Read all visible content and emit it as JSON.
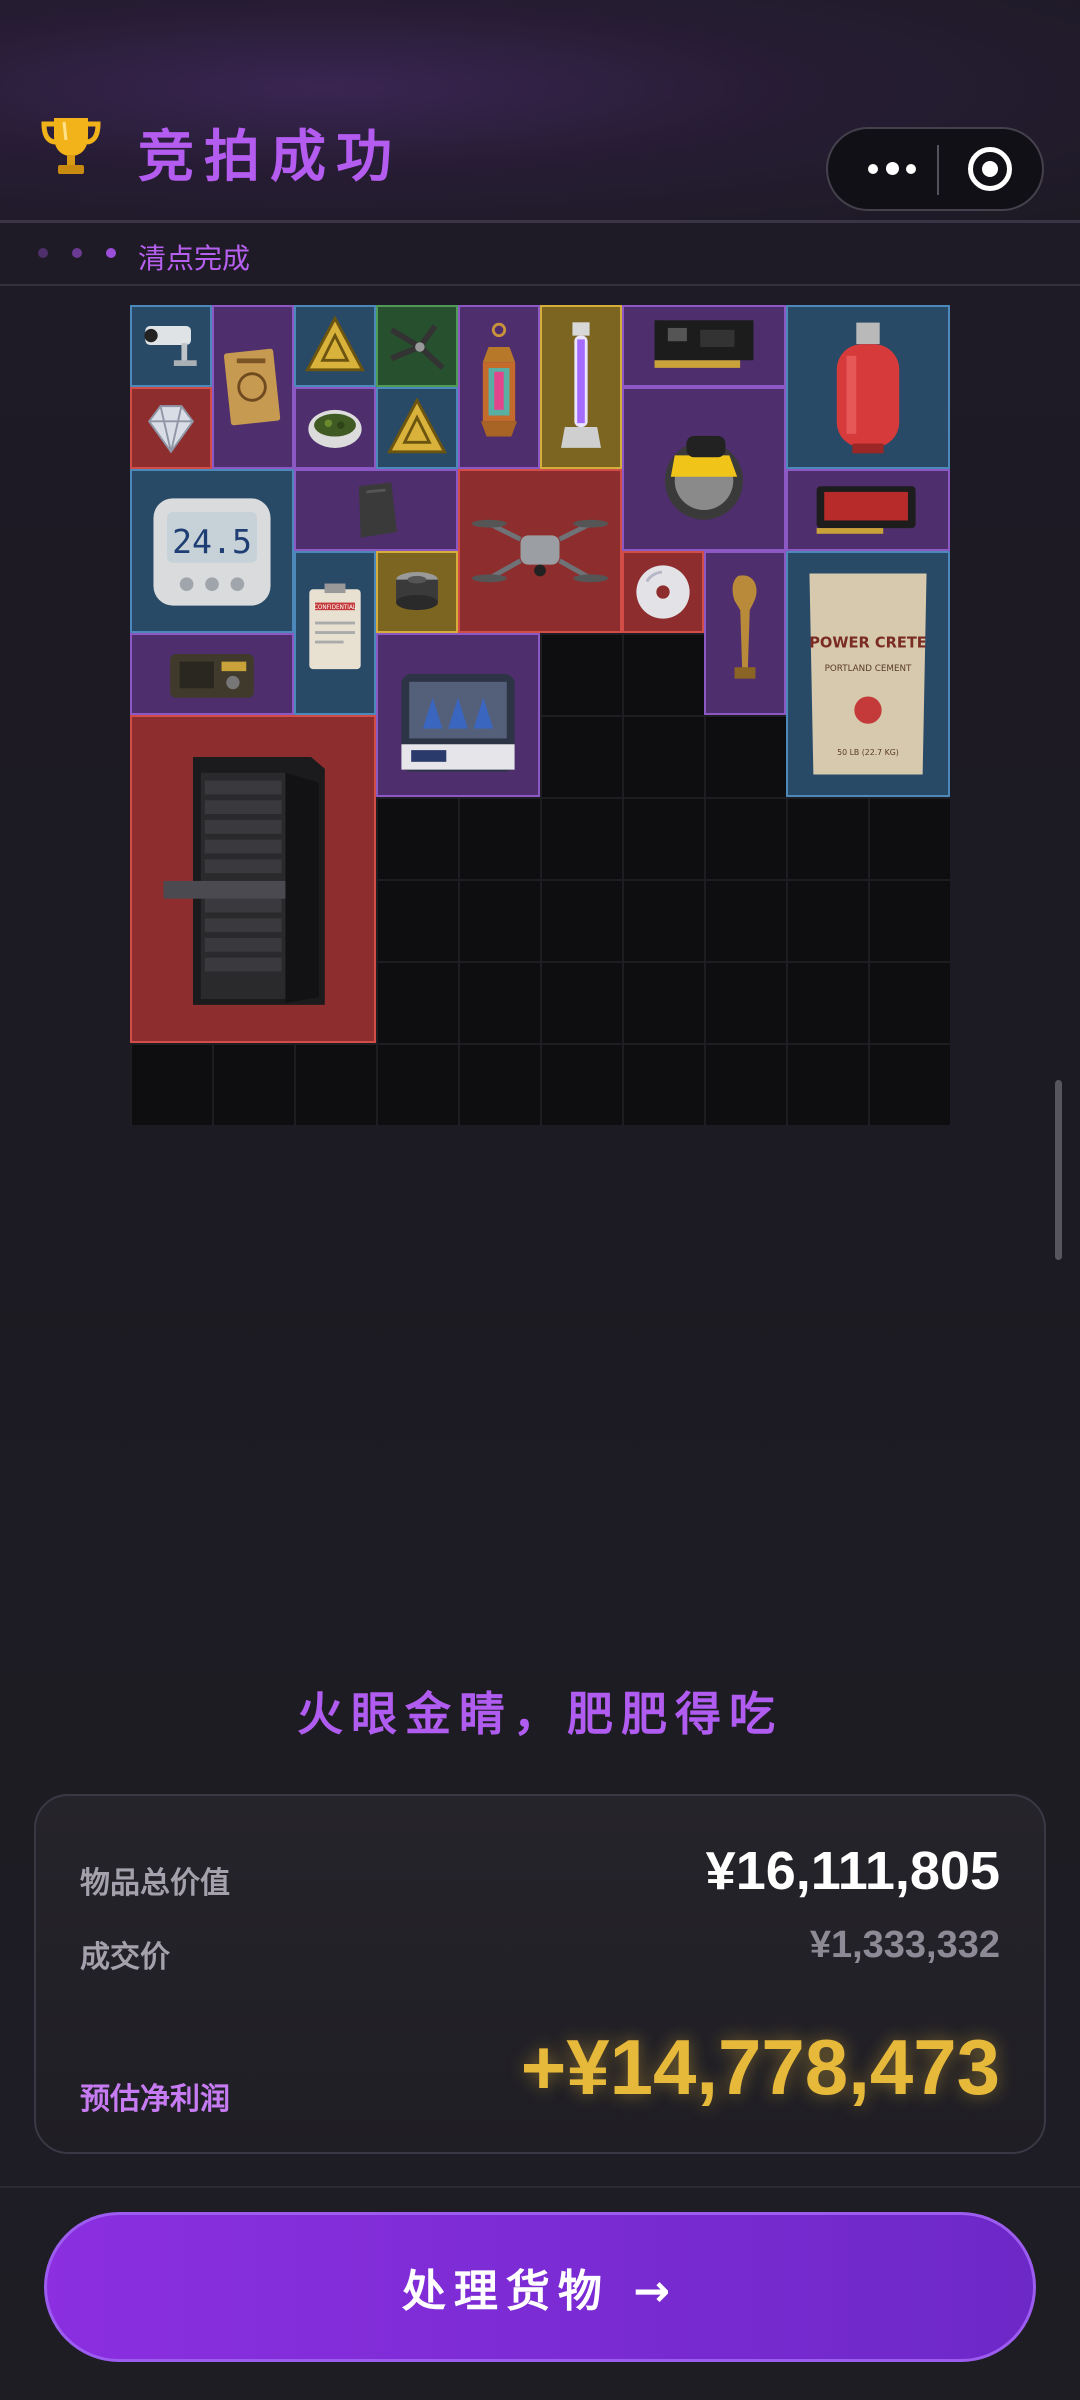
{
  "header": {
    "title": "竞拍成功",
    "icons": [
      "trophy-icon",
      "more-icon",
      "target-icon"
    ]
  },
  "status": {
    "text": "清点完成",
    "dot_colors": [
      "#4f2f69",
      "#6b3a92",
      "#9b4ed8"
    ]
  },
  "inventory": {
    "grid_cols": 10,
    "grid_rows": 10,
    "items": [
      {
        "name": "security-camera",
        "rarity": "blue"
      },
      {
        "name": "document-folder",
        "rarity": "purple"
      },
      {
        "name": "warning-sign",
        "rarity": "blue"
      },
      {
        "name": "pliers",
        "rarity": "green"
      },
      {
        "name": "lantern",
        "rarity": "purple"
      },
      {
        "name": "uv-lamp",
        "rarity": "gold"
      },
      {
        "name": "circuit-board",
        "rarity": "purple"
      },
      {
        "name": "gas-cylinder",
        "rarity": "blue"
      },
      {
        "name": "diamond",
        "rarity": "red"
      },
      {
        "name": "herb-bowl",
        "rarity": "purple"
      },
      {
        "name": "warning-sign",
        "rarity": "blue"
      },
      {
        "name": "circular-saw",
        "rarity": "purple"
      },
      {
        "name": "thermometer",
        "rarity": "blue"
      },
      {
        "name": "stone-shard",
        "rarity": "purple"
      },
      {
        "name": "drone",
        "rarity": "red"
      },
      {
        "name": "graphics-card",
        "rarity": "purple"
      },
      {
        "name": "confidential-clipboard",
        "rarity": "blue"
      },
      {
        "name": "filter-canister",
        "rarity": "gold"
      },
      {
        "name": "cd-disc",
        "rarity": "red"
      },
      {
        "name": "bronze-statue",
        "rarity": "purple"
      },
      {
        "name": "cement-bag",
        "rarity": "blue"
      },
      {
        "name": "radio",
        "rarity": "purple"
      },
      {
        "name": "lab-shaker",
        "rarity": "purple"
      },
      {
        "name": "server-rack",
        "rarity": "red"
      }
    ],
    "item_text": {
      "thermometer_reading": "24.5",
      "cement_brand": "POWER CRETE",
      "cement_type": "PORTLAND CEMENT",
      "cement_weight": "50 LB (22.7 KG)",
      "clipboard_label": "CONFIDENTIAL"
    }
  },
  "slogan": "火眼金睛，肥肥得吃",
  "summary": {
    "total_label": "物品总价值",
    "total_value": "¥16,111,805",
    "deal_label": "成交价",
    "deal_value": "¥1,333,332",
    "profit_label": "预估净利润",
    "profit_value": "+¥14,778,473",
    "colors": {
      "profit": "#e7b93a",
      "profit_label": "#c77bf2",
      "deal": "#8d8a95"
    }
  },
  "cta": {
    "label": "处理货物 →"
  }
}
